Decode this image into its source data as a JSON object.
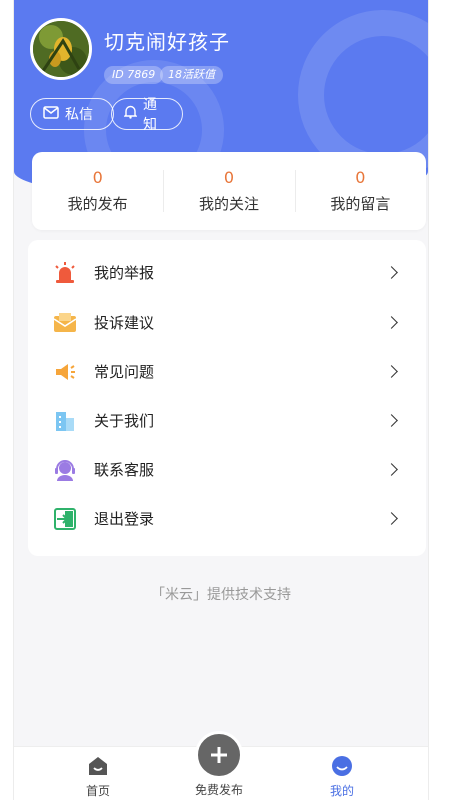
{
  "profile": {
    "username": "切克闹好孩子",
    "id_tag": "ID 7869",
    "activity_tag": "18活跃值",
    "message_button": "私信",
    "notice_button": "通知"
  },
  "stats": [
    {
      "count": "0",
      "label": "我的发布"
    },
    {
      "count": "0",
      "label": "我的关注"
    },
    {
      "count": "0",
      "label": "我的留言"
    }
  ],
  "menu": [
    {
      "label": "我的举报",
      "icon": "alarm-icon"
    },
    {
      "label": "投诉建议",
      "icon": "envelope-icon"
    },
    {
      "label": "常见问题",
      "icon": "megaphone-icon"
    },
    {
      "label": "关于我们",
      "icon": "building-icon"
    },
    {
      "label": "联系客服",
      "icon": "headset-icon"
    },
    {
      "label": "退出登录",
      "icon": "logout-icon"
    }
  ],
  "support_text": "「米云」提供技术支持",
  "tabbar": {
    "home": "首页",
    "publish": "免费发布",
    "me": "我的"
  },
  "colors": {
    "header_blue": "#5b7af0",
    "count_orange": "#e8763a",
    "active_tab": "#4a6fe3"
  }
}
